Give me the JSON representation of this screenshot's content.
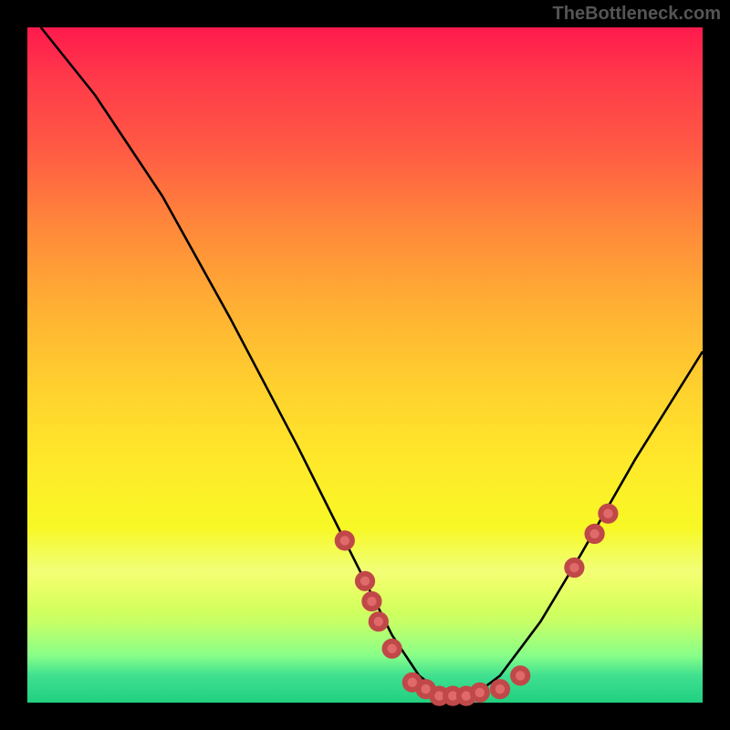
{
  "watermark": "TheBottleneck.com",
  "chart_data": {
    "type": "line",
    "title": "",
    "xlabel": "",
    "ylabel": "",
    "xlim": [
      0,
      100
    ],
    "ylim": [
      0,
      100
    ],
    "series": [
      {
        "name": "curve",
        "x": [
          2,
          10,
          20,
          30,
          40,
          48,
          54,
          58,
          62,
          66,
          70,
          76,
          82,
          90,
          100
        ],
        "y": [
          100,
          90,
          75,
          57,
          38,
          22,
          10,
          4,
          1,
          1,
          4,
          12,
          22,
          36,
          52
        ]
      }
    ],
    "markers": [
      {
        "x": 47,
        "y": 24
      },
      {
        "x": 50,
        "y": 18
      },
      {
        "x": 51,
        "y": 15
      },
      {
        "x": 52,
        "y": 12
      },
      {
        "x": 54,
        "y": 8
      },
      {
        "x": 57,
        "y": 3
      },
      {
        "x": 59,
        "y": 2
      },
      {
        "x": 61,
        "y": 1
      },
      {
        "x": 63,
        "y": 1
      },
      {
        "x": 65,
        "y": 1
      },
      {
        "x": 67,
        "y": 1.5
      },
      {
        "x": 70,
        "y": 2
      },
      {
        "x": 73,
        "y": 4
      },
      {
        "x": 81,
        "y": 20
      },
      {
        "x": 84,
        "y": 25
      },
      {
        "x": 86,
        "y": 28
      }
    ],
    "background": "vertical-gradient red→yellow→green",
    "grid": false
  }
}
